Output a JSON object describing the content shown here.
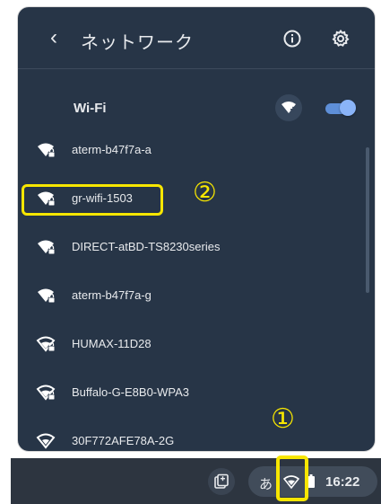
{
  "header": {
    "title": "ネットワーク",
    "back_icon": "chevron-left-icon",
    "info_icon": "info-icon",
    "settings_icon": "gear-icon"
  },
  "wifi": {
    "label": "Wi-Fi",
    "add_icon": "add-wifi-icon",
    "enabled": true
  },
  "networks": [
    {
      "name": "aterm-b47f7a-a",
      "icon": "wifi-lock-icon"
    },
    {
      "name": "gr-wifi-1503",
      "icon": "wifi-lock-icon"
    },
    {
      "name": "DIRECT-atBD-TS8230series",
      "icon": "wifi-lock-icon"
    },
    {
      "name": "aterm-b47f7a-g",
      "icon": "wifi-lock-icon"
    },
    {
      "name": "HUMAX-11D28",
      "icon": "wifi-lock-icon"
    },
    {
      "name": "Buffalo-G-E8B0-WPA3",
      "icon": "wifi-lock-icon"
    },
    {
      "name": "30F772AFE78A-2G",
      "icon": "wifi-icon"
    }
  ],
  "annotations": {
    "step1": "①",
    "step2": "②"
  },
  "shelf": {
    "hold_icon": "clipboard-icon",
    "ime": "あ",
    "network_icon": "wifi-icon",
    "battery_icon": "battery-icon",
    "time": "16:22"
  },
  "colors": {
    "panel_bg": "#273547",
    "accent": "#8ab4f8",
    "annotation": "#f7e600",
    "shelf_bg": "#2d3540"
  }
}
